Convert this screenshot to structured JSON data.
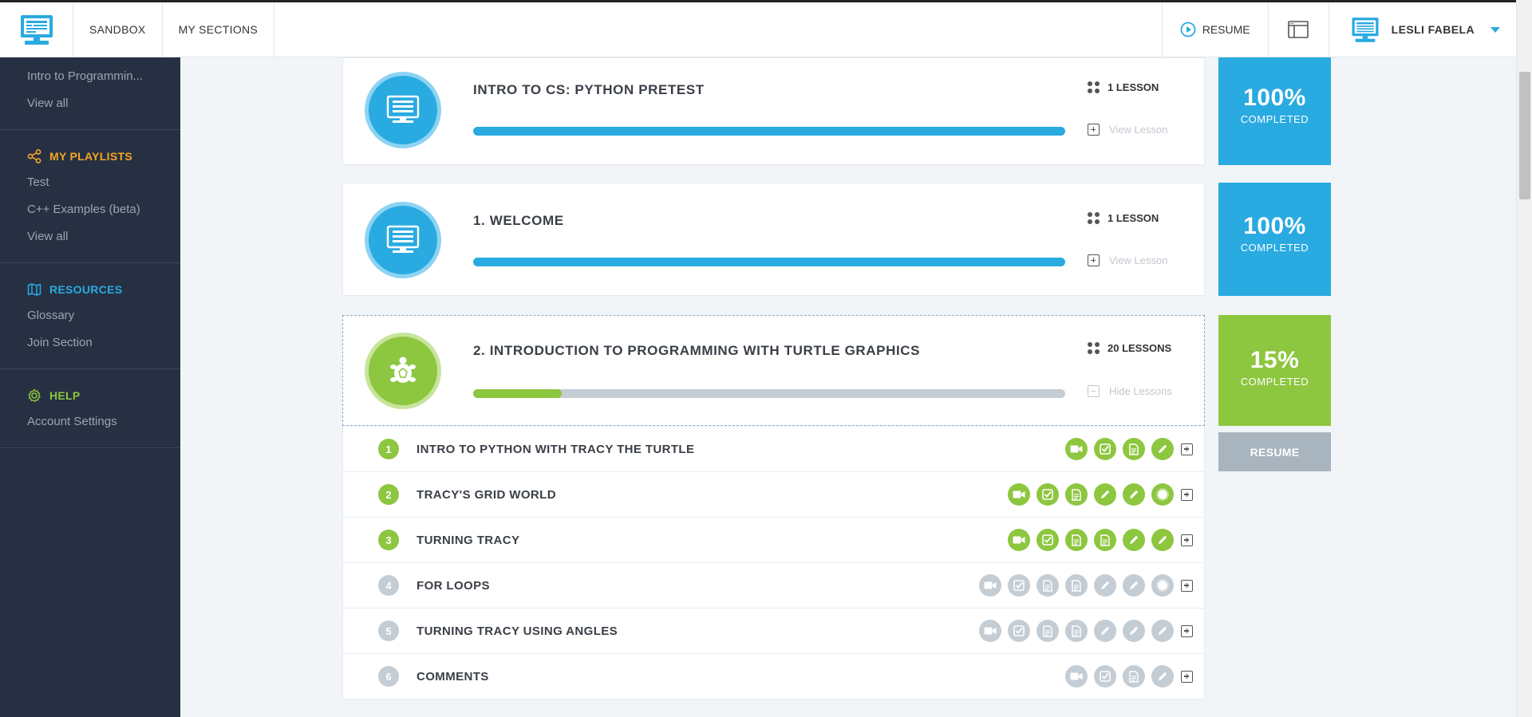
{
  "topbar": {
    "nav": [
      "SANDBOX",
      "MY SECTIONS"
    ],
    "resume_label": "RESUME",
    "user_name": "LESLI FABELA"
  },
  "sidebar": {
    "course_link": "Intro to Programmin...",
    "course_view_all": "View all",
    "playlists_heading": "MY PLAYLISTS",
    "playlists": [
      "Test",
      "C++ Examples (beta)",
      "View all"
    ],
    "resources_heading": "RESOURCES",
    "resources": [
      "Glossary",
      "Join Section"
    ],
    "help_heading": "HELP",
    "help": [
      "Account Settings"
    ]
  },
  "units": [
    {
      "title": "INTRO TO CS: PYTHON PRETEST",
      "lessons": "1 LESSON",
      "toggle": "View Lesson",
      "progress": 1.0,
      "pct": "100%",
      "pct_label": "COMPLETED"
    },
    {
      "title": "1. WELCOME",
      "lessons": "1 LESSON",
      "toggle": "View Lesson",
      "progress": 1.0,
      "pct": "100%",
      "pct_label": "COMPLETED"
    },
    {
      "title": "2. INTRODUCTION TO PROGRAMMING WITH TURTLE GRAPHICS",
      "lessons": "20 LESSONS",
      "toggle": "Hide Lessons",
      "progress": 0.15,
      "pct": "15%",
      "pct_label": "COMPLETED",
      "resume": "RESUME"
    }
  ],
  "lessons": [
    {
      "num": "1",
      "title": "INTRO TO PYTHON WITH TRACY THE TURTLE",
      "done": true,
      "activities": [
        "video-icon",
        "quiz-check-icon",
        "document-icon",
        "pencil-icon"
      ]
    },
    {
      "num": "2",
      "title": "TRACY'S GRID WORLD",
      "done": true,
      "activities": [
        "video-icon",
        "quiz-check-icon",
        "document-icon",
        "pencil-icon",
        "pencil-icon",
        "badge-icon"
      ]
    },
    {
      "num": "3",
      "title": "TURNING TRACY",
      "done": true,
      "activities": [
        "video-icon",
        "quiz-check-icon",
        "document-icon",
        "document-icon",
        "pencil-icon",
        "pencil-icon"
      ]
    },
    {
      "num": "4",
      "title": "FOR LOOPS",
      "done": false,
      "activities": [
        "video-icon",
        "quiz-check-icon",
        "document-icon",
        "document-icon",
        "pencil-icon",
        "pencil-icon",
        "badge-icon"
      ]
    },
    {
      "num": "5",
      "title": "TURNING TRACY USING ANGLES",
      "done": false,
      "activities": [
        "video-icon",
        "quiz-check-icon",
        "document-icon",
        "document-icon",
        "pencil-icon",
        "pencil-icon",
        "pencil-icon"
      ]
    },
    {
      "num": "6",
      "title": "COMMENTS",
      "done": false,
      "activities": [
        "video-icon",
        "quiz-check-icon",
        "document-icon",
        "pencil-icon"
      ]
    }
  ],
  "colors": {
    "blue": "#29aae1",
    "green": "#8dc63f",
    "gray": "#c4ccd4",
    "sidebar": "#263042"
  }
}
